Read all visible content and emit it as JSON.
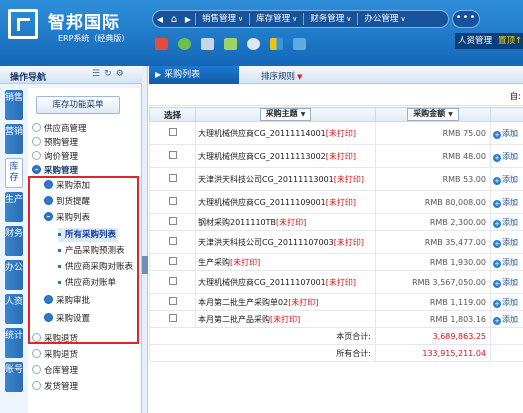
{
  "header": {
    "logo_title": "智邦国际",
    "logo_subtitle": "ERP系统（经典版）",
    "nav_items": [
      {
        "label": "销售管理"
      },
      {
        "label": "库存管理"
      },
      {
        "label": "财务管理"
      },
      {
        "label": "办公管理"
      }
    ],
    "more_label": "•••",
    "side_tabs": [
      "人资管理",
      "置顶↑"
    ]
  },
  "left": {
    "title": "操作导航",
    "vertical_tabs": [
      "销售",
      "营销",
      "库存",
      "生产",
      "财务",
      "办公",
      "人资",
      "统计",
      "账号"
    ],
    "func_button": "库存功能菜单",
    "tree": [
      {
        "label": "供应商管理"
      },
      {
        "label": "预购管理"
      },
      {
        "label": "询价管理"
      },
      {
        "label": "采购管理"
      },
      {
        "label": "采购添加"
      },
      {
        "label": "到货提醒"
      },
      {
        "label": "采购列表"
      },
      {
        "label": "所有采购列表"
      },
      {
        "label": "产品采购预测表"
      },
      {
        "label": "供应商采购对账表"
      },
      {
        "label": "供应商对账单"
      },
      {
        "label": "采购审批"
      },
      {
        "label": "采购设置"
      },
      {
        "label": "采购退货"
      },
      {
        "label": "采购退货"
      },
      {
        "label": "仓库管理"
      },
      {
        "label": "发货管理"
      }
    ]
  },
  "main": {
    "tab_title": "采购列表",
    "sort_label": "排序规则",
    "sub_text": "自:",
    "columns": {
      "select": "选择",
      "subject": "采购主题",
      "amount": "采购金额"
    },
    "rows": [
      {
        "subject": "大理机械供应商CG_20111114001",
        "tag": "[未打印]",
        "amount": "RMB 75.00",
        "action": "添加"
      },
      {
        "subject": "大理机械供应商CG_20111113002",
        "tag": "[未打印]",
        "amount": "RMB 48.00",
        "action": "添加"
      },
      {
        "subject": "天津洪天科技公司CG_20111113001",
        "tag": "[未打印]",
        "amount": "RMB 53.00",
        "action": "添加"
      },
      {
        "subject": "大理机械供应商CG_20111109001",
        "tag": "[未打印]",
        "amount": "RMB 80,008.00",
        "action": "添加"
      },
      {
        "subject": "钢材采购2011110TB",
        "tag": "[未打印]",
        "amount": "RMB 2,300.00",
        "action": "添加"
      },
      {
        "subject": "天津洪天科技公司CG_20111107003",
        "tag": "[未打印]",
        "amount": "RMB 35,477.00",
        "action": "添加"
      },
      {
        "subject": "生产采购",
        "tag": "[未打印]",
        "amount": "RMB 1,930.00",
        "action": "添加"
      },
      {
        "subject": "大理机械供应商CG_20111107001",
        "tag": "[未打印]",
        "amount": "RMB 3,567,050.00",
        "action": "添加"
      },
      {
        "subject": "本月第二批生产采购单02",
        "tag": "[未打印]",
        "amount": "RMB 1,119.00",
        "action": "添加"
      },
      {
        "subject": "本月第二批产品采购",
        "tag": "[未打印]",
        "amount": "RMB 1,803.16",
        "action": "添加"
      }
    ],
    "page_total_label": "本页合计:",
    "page_total_value": "3,689,863.25",
    "all_total_label": "所有合计:",
    "all_total_value": "133,915,211.04"
  },
  "colors": {
    "header_blue": "#1a6fc4",
    "highlight_red": "#e0242a",
    "tag_red": "#d5141b"
  }
}
